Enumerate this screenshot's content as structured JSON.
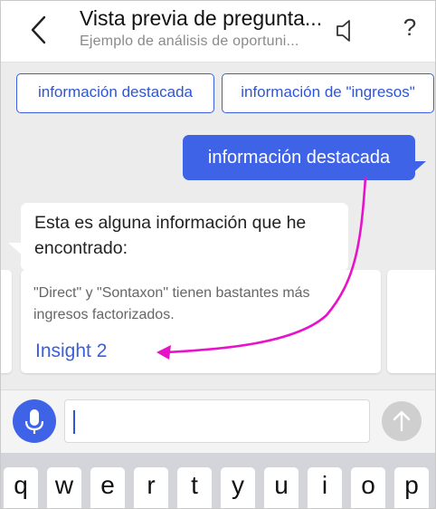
{
  "header": {
    "title": "Vista previa de pregunta...",
    "subtitle": "Ejemplo de análisis de oportuni...",
    "help_label": "?"
  },
  "suggestions": [
    {
      "label": "información destacada"
    },
    {
      "label": "información de \"ingresos\""
    }
  ],
  "messages": {
    "user": "información destacada",
    "bot": "Esta es alguna información que he encontrado:"
  },
  "insight_card": {
    "text": "\"Direct\" y \"Sontaxon\" tienen bastantes más ingresos factorizados.",
    "link_label": "Insight 2"
  },
  "input": {
    "value": ""
  },
  "keyboard": {
    "keys": [
      "q",
      "w",
      "e",
      "r",
      "t",
      "y",
      "u",
      "i",
      "o",
      "p"
    ]
  },
  "colors": {
    "accent": "#3f63e6",
    "annotation_arrow": "#e613c9",
    "background": "#ececec"
  },
  "icons": {
    "back": "chevron-left-icon",
    "speaker": "speaker-icon",
    "mic": "microphone-icon",
    "send": "arrow-up-icon"
  }
}
